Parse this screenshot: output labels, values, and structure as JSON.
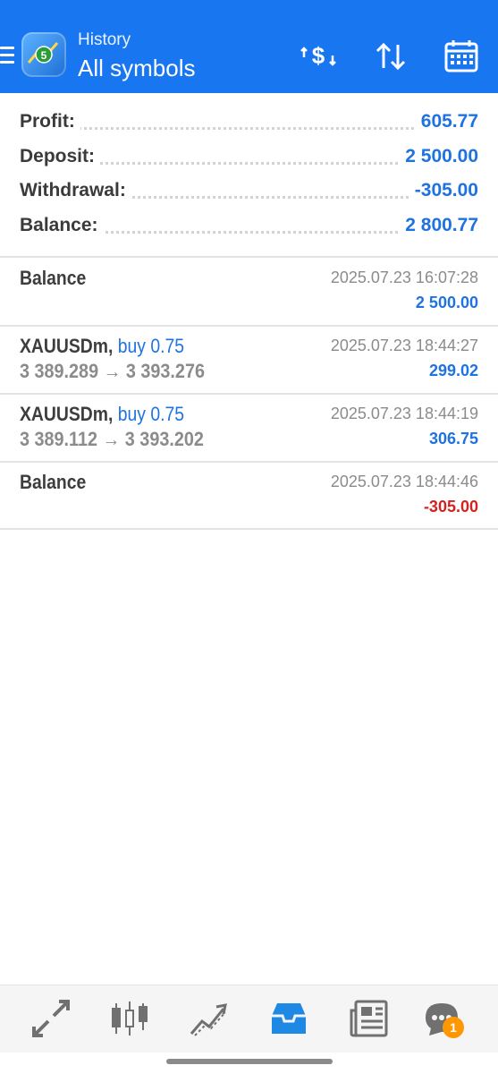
{
  "header": {
    "subtitle": "History",
    "title": "All symbols",
    "icons": [
      "menu-icon",
      "app-logo",
      "dollar-swap-icon",
      "sort-icon",
      "calendar-icon"
    ],
    "bg_color": "#1876f1"
  },
  "summary": [
    {
      "label": "Profit:",
      "value": "605.77"
    },
    {
      "label": "Deposit:",
      "value": "2 500.00"
    },
    {
      "label": "Withdrawal:",
      "value": "-305.00"
    },
    {
      "label": "Balance:",
      "value": "2 800.77"
    }
  ],
  "deals": [
    {
      "title": "Balance",
      "side": "",
      "prices": "",
      "time": "2025.07.23 16:07:28",
      "amount": "2 500.00",
      "negative": false
    },
    {
      "title": "XAUUSDm,",
      "side": "buy 0.75",
      "prices": "3 389.289 → 3 393.276",
      "time": "2025.07.23 18:44:27",
      "amount": "299.02",
      "negative": false
    },
    {
      "title": "XAUUSDm,",
      "side": "buy 0.75",
      "prices": "3 389.112 → 3 393.202",
      "time": "2025.07.23 18:44:19",
      "amount": "306.75",
      "negative": false
    },
    {
      "title": "Balance",
      "side": "",
      "prices": "",
      "time": "2025.07.23 18:44:46",
      "amount": "-305.00",
      "negative": true
    }
  ],
  "bottom_nav": {
    "items": [
      "quotes-icon",
      "chart-icon",
      "trade-icon",
      "history-icon",
      "news-icon",
      "chat-icon"
    ],
    "active": "history-icon",
    "chat_badge": "1"
  },
  "colors": {
    "accent": "#1e73e0",
    "negative": "#d42222",
    "badge": "#ff9800"
  }
}
